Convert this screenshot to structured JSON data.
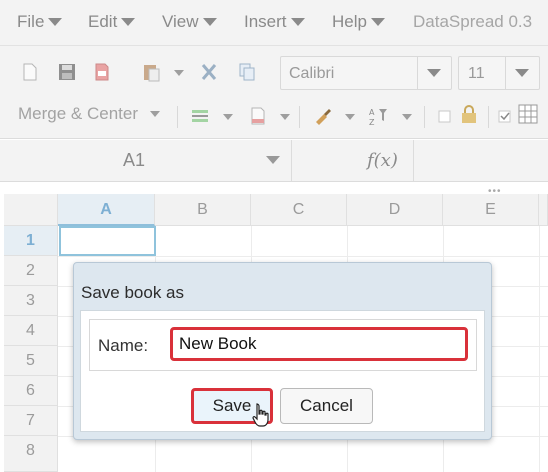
{
  "menubar": {
    "items": [
      {
        "label": "File"
      },
      {
        "label": "Edit"
      },
      {
        "label": "View"
      },
      {
        "label": "Insert"
      },
      {
        "label": "Help"
      }
    ],
    "app_name": "DataSpread 0.3"
  },
  "toolbar": {
    "font_name": "Calibri",
    "font_size": "11",
    "merge_label": "Merge & Center",
    "icons": [
      "new-file-icon",
      "save-icon",
      "pdf-icon",
      "paste-icon",
      "cut-icon",
      "copy-icon",
      "border-icon",
      "insert-icon",
      "format-painter-icon",
      "sort-filter-icon",
      "lock-icon",
      "gridlines-icon"
    ]
  },
  "formulabar": {
    "cell_ref": "A1",
    "fx_label": "f(x)"
  },
  "grid": {
    "columns": [
      "A",
      "B",
      "C",
      "D",
      "E"
    ],
    "rows": [
      "1",
      "2",
      "3",
      "4",
      "5",
      "6",
      "7",
      "8"
    ],
    "active_column": "A",
    "active_row": "1",
    "splitter": "•••"
  },
  "dialog": {
    "title": "Save book as",
    "name_label": "Name:",
    "name_value": "New Book",
    "save_label": "Save",
    "cancel_label": "Cancel"
  },
  "colors": {
    "highlight": "#d9313a",
    "selection": "#8fc3dc",
    "dialog_bg": "#dde7ef"
  }
}
